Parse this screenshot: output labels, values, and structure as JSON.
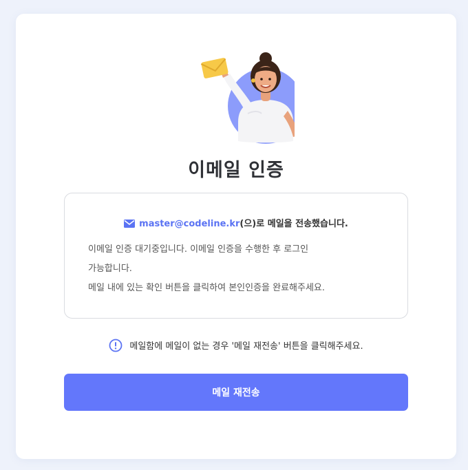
{
  "page": {
    "title": "이메일 인증"
  },
  "info": {
    "email": "master@codeline.kr",
    "sent_message": "(으)로 메일을 전송했습니다.",
    "lines": [
      "이메일 인증 대기중입니다. 이메일 인증을 수행한 후 로그인",
      "가능합니다.",
      "메일 내에 있는 확인 버튼을 클릭하여 본인인증을 완료해주세요."
    ]
  },
  "notice": {
    "text": "메일함에 메일이 없는 경우 '메일 재전송' 버튼을 클릭해주세요."
  },
  "actions": {
    "resend_label": "메일 재전송"
  },
  "colors": {
    "accent": "#6377fb",
    "email_link": "#5b73f3",
    "background": "#eef2fb"
  },
  "icons": {
    "mail": "mail-icon",
    "notice": "info-circle-icon"
  }
}
